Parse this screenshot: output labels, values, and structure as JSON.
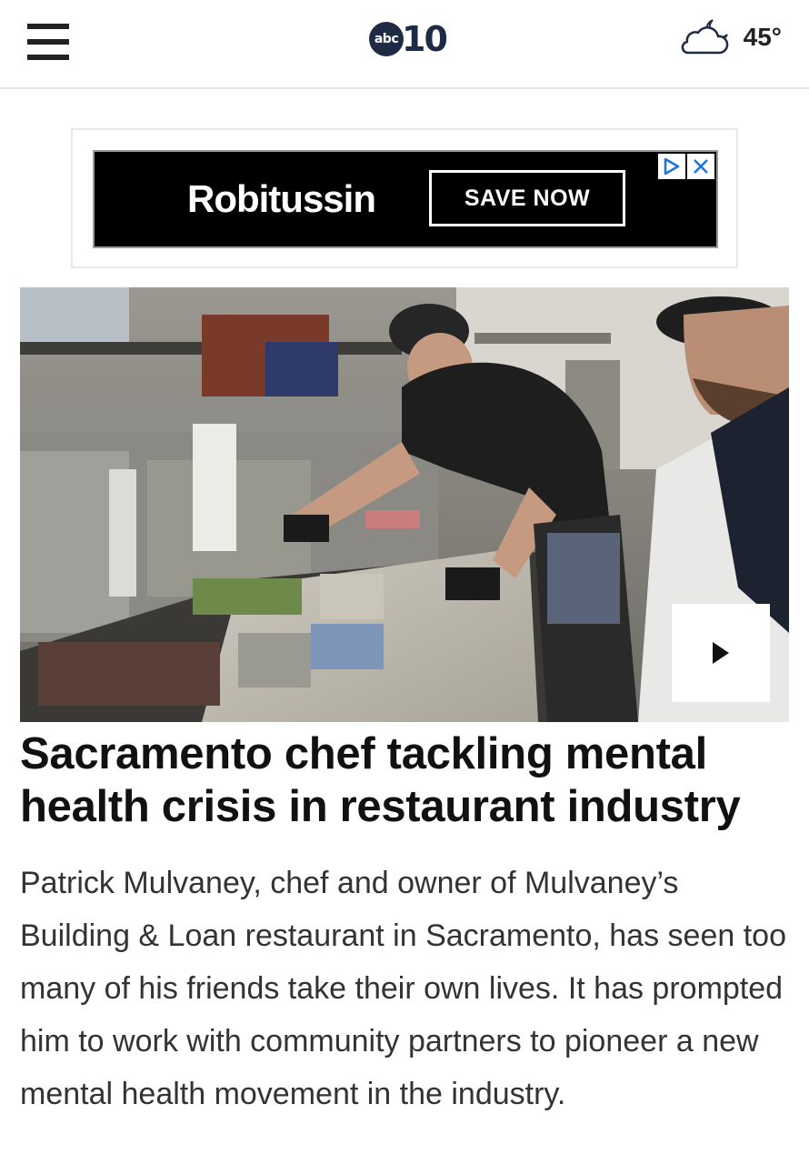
{
  "header": {
    "logo_badge": "abc",
    "logo_number": "10",
    "weather_icon": "partly-cloudy-night-icon",
    "temperature": "45°",
    "menu_icon": "hamburger-menu-icon"
  },
  "ad": {
    "brand": "Robitussin",
    "trademark": "*",
    "cta": "SAVE NOW",
    "adchoices_icon": "adchoices-icon",
    "close_icon": "close-icon"
  },
  "video": {
    "play_icon": "play-icon"
  },
  "article": {
    "headline": "Sacramento chef tackling mental health crisis in restaurant industry",
    "summary": "Patrick Mulvaney, chef and owner of Mulvaney’s Building & Loan restaurant in Sacramento, has seen too many of his friends take their own lives. It has prompted him to work with community partners to pioneer a new mental health movement in the industry."
  },
  "colors": {
    "brand_navy": "#1f2a44",
    "ad_background": "#000000",
    "adchoices_blue": "#1a73e8"
  }
}
